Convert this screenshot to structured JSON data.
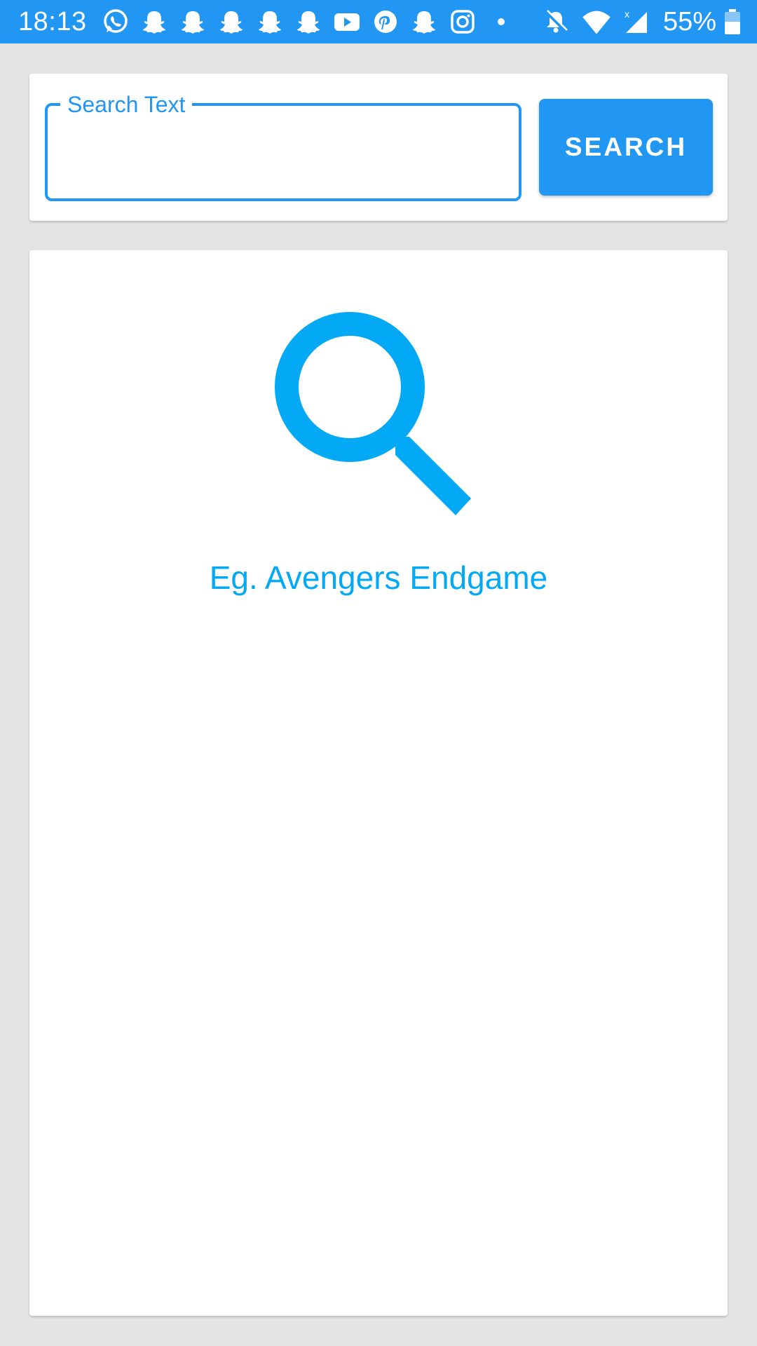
{
  "status_bar": {
    "time": "18:13",
    "battery": "55%",
    "background": "#2196f3",
    "notification_icons": [
      "whatsapp-icon",
      "snapchat-icon",
      "snapchat-icon",
      "snapchat-icon",
      "snapchat-icon",
      "snapchat-icon",
      "youtube-icon",
      "pinterest-icon",
      "snapchat-icon",
      "instagram-icon",
      "dot-icon"
    ],
    "system_icons": [
      "bell-off-icon",
      "wifi-icon",
      "cell-signal-icon",
      "battery-icon"
    ]
  },
  "search": {
    "label": "Search Text",
    "value": "",
    "button_label": "SEARCH"
  },
  "results": {
    "hint": "Eg. Avengers Endgame",
    "icon": "search-icon",
    "icon_color": "#03a9f4"
  },
  "colors": {
    "accent": "#2196f3",
    "hint": "#03a9f4",
    "background": "#e4e4e4"
  }
}
